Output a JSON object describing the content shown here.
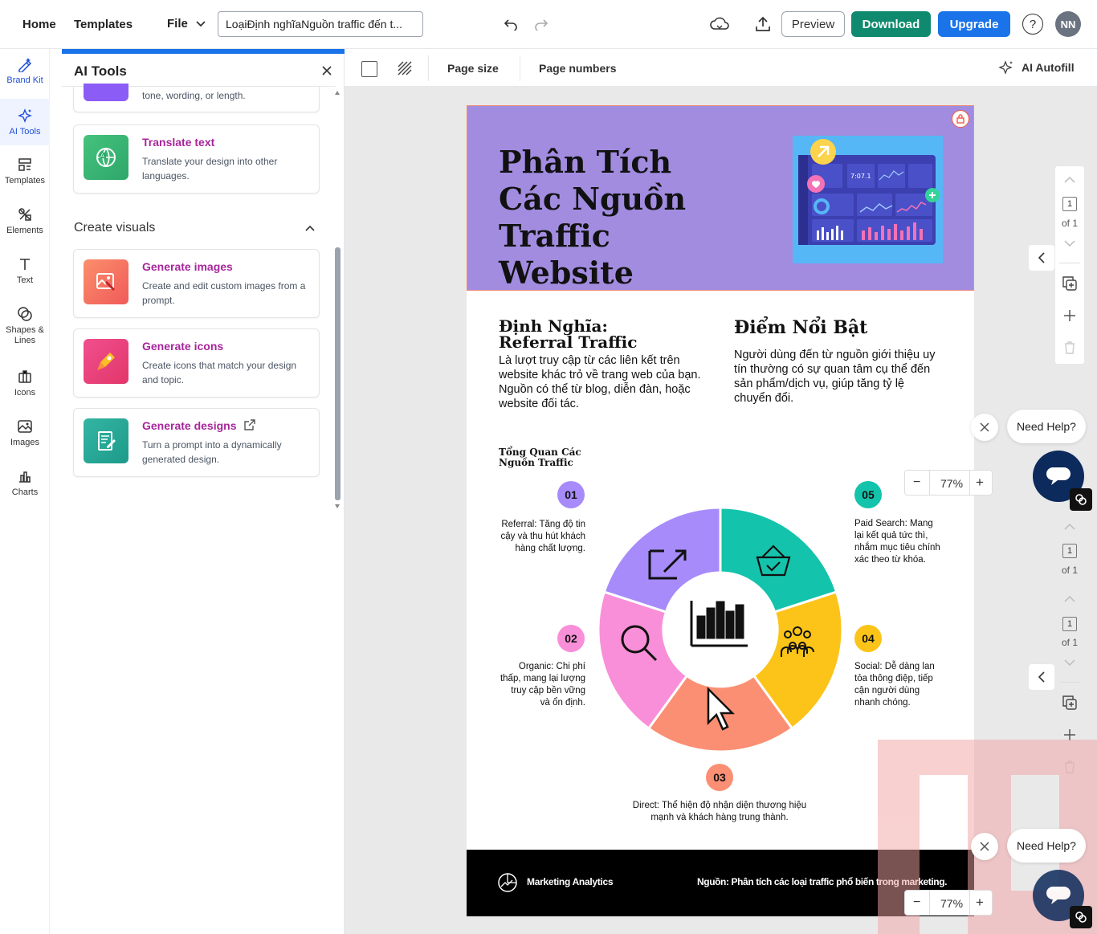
{
  "topbar": {
    "home": "Home",
    "templates": "Templates",
    "file": "File",
    "doc_title": "LoạiĐịnh nghĩaNguồn traffic đến t...",
    "preview": "Preview",
    "download": "Download",
    "upgrade": "Upgrade",
    "help": "?",
    "avatar": "NN"
  },
  "rail": {
    "items": [
      {
        "label": "Brand Kit",
        "icon": "brand-kit-icon"
      },
      {
        "label": "AI Tools",
        "icon": "ai-tools-icon"
      },
      {
        "label": "Templates",
        "icon": "templates-icon"
      },
      {
        "label": "Elements",
        "icon": "elements-icon"
      },
      {
        "label": "Text",
        "icon": "text-icon"
      },
      {
        "label": "Shapes & Lines",
        "icon": "shapes-icon"
      },
      {
        "label": "Icons",
        "icon": "icons-icon"
      },
      {
        "label": "Images",
        "icon": "images-icon"
      },
      {
        "label": "Charts",
        "icon": "charts-icon"
      }
    ]
  },
  "panel": {
    "title": "AI Tools",
    "partial_card_text": "tone, wording, or length.",
    "translate": {
      "title": "Translate text",
      "desc": "Translate your design into other languages."
    },
    "section": "Create visuals",
    "gen_images": {
      "title": "Generate images",
      "desc": "Create and edit custom images from a prompt."
    },
    "gen_icons": {
      "title": "Generate icons",
      "desc": "Create icons that match your design and topic."
    },
    "gen_designs": {
      "title": "Generate designs",
      "desc": "Turn a prompt into a dynamically generated design."
    }
  },
  "subbar": {
    "page_size": "Page size",
    "page_numbers": "Page numbers",
    "ai_autofill": "AI Autofill"
  },
  "page": {
    "header_title": "Phân Tích Các Nguồn Traffic Website",
    "dash_value": "7:07.1",
    "def_title": "Định Nghĩa: Referral Traffic",
    "def_body": "Là lượt truy cập từ các liên kết trên website khác trỏ về trang web của bạn. Nguồn có thể từ blog, diễn đàn, hoặc website đối tác.",
    "hl_title": "Điểm Nổi Bật",
    "hl_body": "Người dùng đến từ nguồn giới thiệu uy tín thường có sự quan tâm cụ thể đến sản phẩm/dịch vụ, giúp tăng tỷ lệ chuyển đổi.",
    "overview_title": "Tổng Quan Các Nguồn Traffic",
    "items": [
      {
        "num": "01",
        "text": "Referral: Tăng độ tin cậy và thu hút khách hàng chất lượng.",
        "color": "#a78bfa"
      },
      {
        "num": "02",
        "text": "Organic: Chi phí thấp, mang lại lượng truy cập bền vững và ổn định.",
        "color": "#f98fd8"
      },
      {
        "num": "03",
        "text": "Direct: Thể hiện độ nhận diện thương hiệu mạnh và khách hàng trung thành.",
        "color": "#fb8f73"
      },
      {
        "num": "04",
        "text": "Social: Dễ dàng lan tỏa thông điệp, tiếp cận người dùng nhanh chóng.",
        "color": "#fbbf24"
      },
      {
        "num": "05",
        "text": "Paid Search: Mang lại kết quả tức thì, nhắm mục tiêu chính xác theo từ khóa.",
        "color": "#14b8a6"
      }
    ],
    "footer_brand": "Marketing Analytics",
    "footer_source": "Nguồn: Phân tích các loại traffic phổ biến trong marketing."
  },
  "controls": {
    "page_num": "1",
    "of_label": "of 1",
    "zoom": "77%",
    "need_help": "Need Help?"
  },
  "colors": {
    "header_bg": "#a28ce0",
    "download": "#0f8a6e",
    "upgrade": "#1a73e8",
    "accent_title": "#a7269b"
  }
}
